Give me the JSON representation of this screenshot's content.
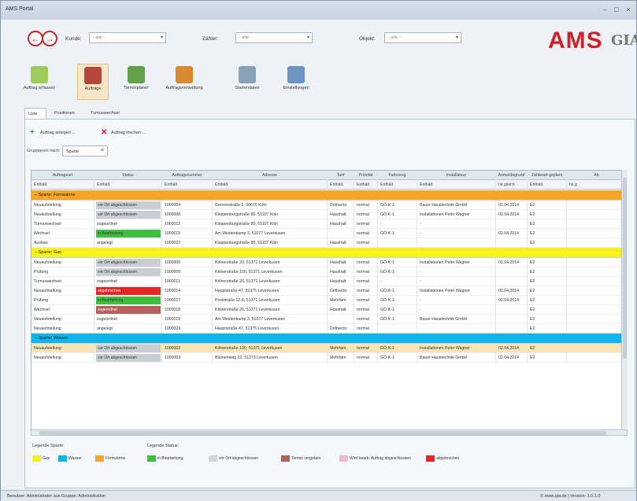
{
  "window": {
    "title": "AMS Portal"
  },
  "topbar": {
    "kunde_label": "Kunde:",
    "kunde_value": "- alle -",
    "zahler_label": "Zähler:",
    "zahler_value": "- alle -",
    "objekt_label": "Objekt:",
    "objekt_value": "- alle -",
    "logo_text": "AMS",
    "logo_sub": "GIA"
  },
  "ribbon": [
    {
      "label": "Auftrag erfassen",
      "color": "#9fcb5a"
    },
    {
      "label": "Aufträge",
      "color": "#b5473a",
      "active": true
    },
    {
      "label": "Terminplaner",
      "color": "#5fa24a"
    },
    {
      "label": "Auftragsverwaltung",
      "color": "#d98a2f"
    },
    {
      "label": "Stammdaten",
      "color": "#8aa0b8"
    },
    {
      "label": "Einstellungen",
      "color": "#6d93c3"
    }
  ],
  "tabs": [
    {
      "label": "Liste",
      "active": true
    },
    {
      "label": "Positionen"
    },
    {
      "label": "Turnuswechsel"
    }
  ],
  "toolbar": {
    "create_label": "Auftrag anlegen ...",
    "delete_label": "Auftrag löschen ..."
  },
  "grouping": {
    "label": "Gruppieren nach:",
    "chip": "Sparte"
  },
  "columns": [
    "Auftragsart",
    "Status",
    "Auftragsnummer",
    "Adresse",
    "Tarif",
    "Priorität",
    "Fahrzeug",
    "Installateur",
    "Anmeldegrund",
    "Zählerart geplant",
    "Ab"
  ],
  "filters": [
    "Enthält",
    "Enthält",
    "Enthält",
    "Enthält",
    "Enthält",
    "Enthält",
    "Enthält",
    "Enthält",
    "Ist gleich",
    "Enthält",
    "Ist g"
  ],
  "groups": [
    {
      "label": "Sparte: Fernwärme",
      "color": "#f6a526",
      "rows": [
        {
          "art": "Neuaufstellung",
          "status": "vor Ort abgeschlossen",
          "sc": "#c9ced4",
          "nr": "1000004",
          "adr": "Gereonstraße 6, 50670 Köln",
          "tarif": "Drittverbr.",
          "prio": "normal",
          "fz": "GÖ-K-1",
          "inst": "Bauer Haustechnik GmbH",
          "dat": "02.04.2014",
          "za": "E2"
        },
        {
          "art": "Neuaufstellung",
          "status": "vor Ort abgeschlossen",
          "sc": "#c9ced4",
          "nr": "1000008",
          "adr": "Kloppenburgstraße 80, 51107 Köln",
          "tarif": "Haushalt",
          "prio": "normal",
          "fz": "GÖ-K-1",
          "inst": "Installationen Peter Wagner",
          "dat": "02.04.2014",
          "za": "E2"
        },
        {
          "art": "Turnuswechsel",
          "status": "zugeordnet",
          "sc": "",
          "nr": "1000012",
          "adr": "Kloppenburgstraße 80, 51107 Köln",
          "tarif": "Haushalt",
          "prio": "normal",
          "fz": "-",
          "inst": "-",
          "dat": "",
          "za": "E2"
        },
        {
          "art": "Wechsel",
          "status": "in Bearbeitung",
          "sc": "#3fbf3f",
          "nr": "1000015",
          "adr": "Am Weidenkamp 3, 51077 Leverkusen",
          "tarif": "",
          "prio": "normal",
          "fz": "GÖ-K-1",
          "inst": "-",
          "dat": "02.04.2014",
          "za": "E2"
        },
        {
          "art": "Ausbau",
          "status": "angelegt",
          "sc": "",
          "nr": "1000022",
          "adr": "Kloppenburgstraße 80, 51107 Köln",
          "tarif": "Haushalt",
          "prio": "normal",
          "fz": "",
          "inst": "",
          "dat": "",
          "za": "E2"
        }
      ]
    },
    {
      "label": "Sparte: Gas",
      "color": "#f7f21b",
      "rows": [
        {
          "art": "Neuaufstellung",
          "status": "vor Ort abgeschlossen",
          "sc": "#c9ced4",
          "nr": "1000006",
          "adr": "Kölnerstraße 20, 51371 Leverkusen",
          "tarif": "Haushalt",
          "prio": "normal",
          "fz": "GÖ-K-1",
          "inst": "Installationen Peter Wagner",
          "dat": "02.04.2014",
          "za": "E2"
        },
        {
          "art": "Prüfung",
          "status": "vor Ort abgeschlossen",
          "sc": "#c9ced4",
          "nr": "1000009",
          "adr": "Kölnerstraße 100, 51371 Leverkusen",
          "tarif": "Haushalt",
          "prio": "normal",
          "fz": "GÖ-K-1",
          "inst": "-",
          "dat": "",
          "za": "E2"
        },
        {
          "art": "Turnuswechsel",
          "status": "zugeordnet",
          "sc": "",
          "nr": "1000011",
          "adr": "Kölnerstraße 20, 51371 Leverkusen",
          "tarif": "Haushalt",
          "prio": "normal",
          "fz": "-",
          "inst": "-",
          "dat": "",
          "za": "E2"
        },
        {
          "art": "Neuaufstellung",
          "status": "abgebrochen",
          "sc": "#e82424",
          "nr": "1000014",
          "adr": "Hauptstraße 47, 51375 Leverkusen",
          "tarif": "Drittverbr.",
          "prio": "normal",
          "fz": "GÖ-K-1",
          "inst": "Installationen Peter Wagner",
          "dat": "02.04.2014",
          "za": "E2"
        },
        {
          "art": "Prüfung",
          "status": "in Bearbeitung",
          "sc": "#3fbf3f",
          "nr": "1000017",
          "adr": "Poststraße 12 A, 51371 Leverkusen",
          "tarif": "Mehrfam.",
          "prio": "normal",
          "fz": "GÖ-K-1",
          "inst": "-",
          "dat": "02.04.2014",
          "za": "E2"
        },
        {
          "art": "Wechsel",
          "status": "zugeordnet",
          "sc": "#b85e5a",
          "nr": "1000018",
          "adr": "Kölnerstraße 20, 51371 Leverkusen",
          "tarif": "Haushalt",
          "prio": "normal",
          "fz": "GÖ-K-1",
          "inst": "-",
          "dat": "",
          "za": "E2"
        },
        {
          "art": "Neuaufstellung",
          "status": "zugeordnet",
          "sc": "",
          "nr": "1000019",
          "adr": "Am Weidenkamp 3, 51077 Leverkusen",
          "tarif": "",
          "prio": "normal",
          "fz": "GÖ-K-1",
          "inst": "Bauer Haustechnik GmbH",
          "dat": "",
          "za": "E2"
        },
        {
          "art": "Neuaufstellung",
          "status": "angelegt",
          "sc": "",
          "nr": "1000023",
          "adr": "Hauptstraße 47, 51375 Leverkusen",
          "tarif": "Drittverbr.",
          "prio": "normal",
          "fz": "",
          "inst": "",
          "dat": "",
          "za": "E2"
        }
      ]
    },
    {
      "label": "Sparte: Wasser",
      "color": "#0fb4ec",
      "rows": [
        {
          "art": "Neuaufstellung",
          "status": "vor Ort abgeschlossen",
          "sc": "#c9ced4",
          "nr": "1000002",
          "adr": "Kölnerstraße 100, 51371 Leverkusen",
          "tarif": "Mehrfam.",
          "prio": "normal",
          "fz": "GÖ-K-1",
          "inst": "Installationen Peter Wagner",
          "dat": "02.04.2014",
          "za": "E2",
          "selected": true
        },
        {
          "art": "Neuaufstellung",
          "status": "vor Ort abgeschlossen",
          "sc": "#c9ced4",
          "nr": "1000003",
          "adr": "Blumenweg 22, 51373 Leverkusen",
          "tarif": "Mehrfam.",
          "prio": "normal",
          "fz": "GÖ-K-1",
          "inst": "Bauer Haustechnik GmbH",
          "dat": "02.04.2014",
          "za": "E2"
        }
      ]
    }
  ],
  "legend": {
    "sparte_title": "Legende Sparte:",
    "status_title": "Legende Status:",
    "sparte": [
      {
        "label": "Gas",
        "color": "#f7f21b"
      },
      {
        "label": "Wasser",
        "color": "#0fb4ec"
      },
      {
        "label": "Fernwärme",
        "color": "#f6a526"
      }
    ],
    "status": [
      {
        "label": "in Bearbeitung",
        "color": "#3fbf3f"
      },
      {
        "label": "vor Ort abgeschlossen",
        "color": "#d3d6da"
      },
      {
        "label": "Termin vergeben",
        "color": "#b85e5a"
      },
      {
        "label": "Wird bearb. Auftrag abgeschlossen",
        "color": "#f4b6cc"
      },
      {
        "label": "abgebrochen",
        "color": "#e82424"
      }
    ]
  },
  "statusbar": {
    "left": "Benutzer: Administrator aus Gruppe: Administration",
    "right": "© www.gia.de | Version: 1.0.1.0"
  }
}
